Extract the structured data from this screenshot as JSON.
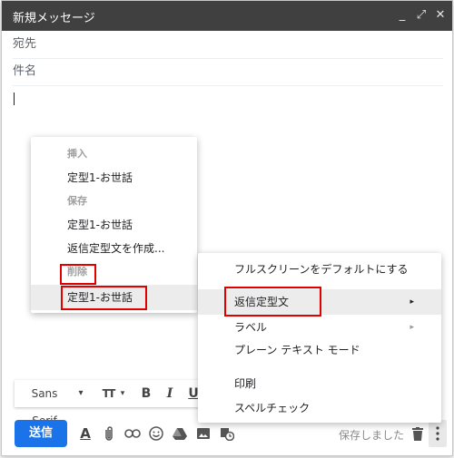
{
  "window": {
    "title": "新規メッセージ",
    "controls": {
      "minimize": "_",
      "popout": "⤢",
      "close": "✕"
    }
  },
  "compose": {
    "to_label": "宛先",
    "subject_label": "件名"
  },
  "canned_menu": {
    "insert_header": "挿入",
    "insert_items": [
      "定型1-お世話"
    ],
    "save_header": "保存",
    "save_items": [
      "定型1-お世話",
      "返信定型文を作成..."
    ],
    "delete_header": "削除",
    "delete_items": [
      "定型1-お世話"
    ]
  },
  "more_menu": {
    "items": [
      {
        "label": "フルスクリーンをデフォルトにする",
        "submenu": false
      },
      {
        "label": "返信定型文",
        "submenu": true,
        "highlighted": true
      },
      {
        "label": "ラベル",
        "submenu": true
      },
      {
        "label": "プレーン テキスト モード",
        "submenu": false
      },
      {
        "label": "印刷",
        "submenu": false
      },
      {
        "label": "スペルチェック",
        "submenu": false
      }
    ],
    "submenu_arrow": "▸"
  },
  "format_bar": {
    "font": "Sans Serif",
    "font_dropdown": "▾",
    "size_icon": "TT",
    "bold": "B",
    "italic": "I",
    "underline": "U"
  },
  "bottom_bar": {
    "send_label": "送信",
    "saved_text": "保存しました",
    "icons": [
      "format-text-icon",
      "attach-icon",
      "link-icon",
      "emoji-icon",
      "drive-icon",
      "photo-icon",
      "schedule-icon"
    ]
  },
  "colors": {
    "titlebar": "#404040",
    "send_button": "#1a73e8",
    "highlight_box": "#e00000"
  }
}
